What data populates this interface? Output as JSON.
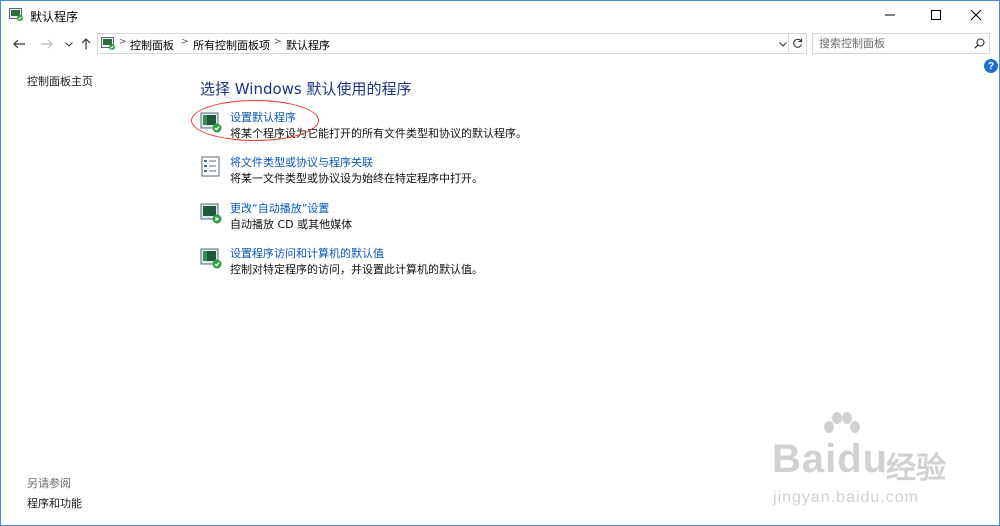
{
  "window": {
    "title": "默认程序",
    "minimize_icon": "minimize-icon",
    "maximize_icon": "maximize-icon",
    "close_icon": "close-icon"
  },
  "nav": {
    "back_icon": "back-arrow-icon",
    "forward_icon": "forward-arrow-icon",
    "recent_icon": "chevron-down-icon",
    "up_icon": "up-arrow-icon",
    "breadcrumbs": [
      "控制面板",
      "所有控制面板项",
      "默认程序"
    ],
    "refresh_icon": "refresh-icon"
  },
  "search": {
    "placeholder": "搜索控制面板",
    "icon": "search-icon"
  },
  "help": {
    "label": "?"
  },
  "left_pane": {
    "home_link": "控制面板主页",
    "see_also_label": "另请参阅",
    "see_also_links": [
      "程序和功能"
    ]
  },
  "main": {
    "heading": "选择 Windows 默认使用的程序",
    "tasks": [
      {
        "link": "设置默认程序",
        "desc": "将某个程序设为它能打开的所有文件类型和协议的默认程序。",
        "icon": "default-programs-icon"
      },
      {
        "link": "将文件类型或协议与程序关联",
        "desc": "将某一文件类型或协议设为始终在特定程序中打开。",
        "icon": "file-association-icon"
      },
      {
        "link": "更改“自动播放”设置",
        "desc": "自动播放 CD 或其他媒体",
        "icon": "autoplay-icon"
      },
      {
        "link": "设置程序访问和计算机的默认值",
        "desc": "控制对特定程序的访问，并设置此计算机的默认值。",
        "icon": "program-access-icon"
      }
    ]
  },
  "watermark": {
    "brand": "Baidu",
    "brand_cn": "经验",
    "url": "jingyan.baidu.com"
  },
  "colors": {
    "heading": "#1e3287",
    "link": "#0a58b8",
    "highlight": "#e53935",
    "border": "#4a8ad8"
  }
}
